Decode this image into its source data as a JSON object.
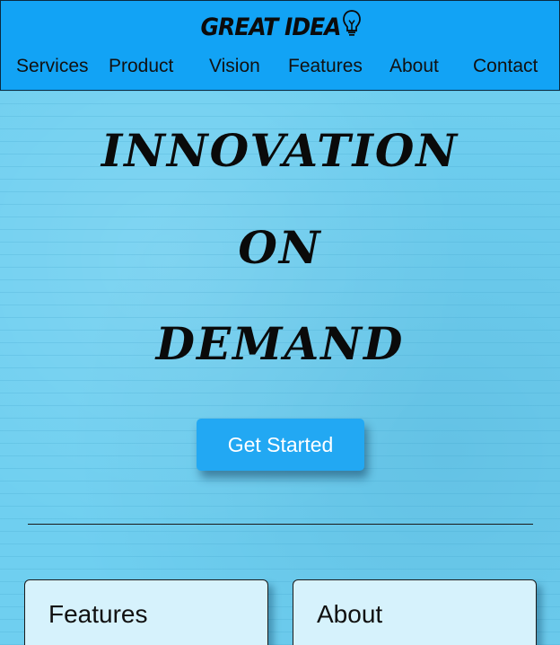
{
  "header": {
    "logo_text": "GREAT IDEA",
    "logo_icon": "lightbulb-icon",
    "background_color": "#12a3f5",
    "nav": [
      {
        "label": "Services"
      },
      {
        "label": "Product"
      },
      {
        "label": "Vision"
      },
      {
        "label": "Features"
      },
      {
        "label": "About"
      },
      {
        "label": "Contact"
      }
    ]
  },
  "hero": {
    "line1": "Innovation",
    "line2": "On",
    "line3": "Demand",
    "cta_label": "Get Started",
    "cta_color": "#22a8f3"
  },
  "cards": [
    {
      "title": "Features"
    },
    {
      "title": "About"
    }
  ],
  "colors": {
    "page_background": "#71d0f0",
    "card_background": "#d6f2fc"
  }
}
